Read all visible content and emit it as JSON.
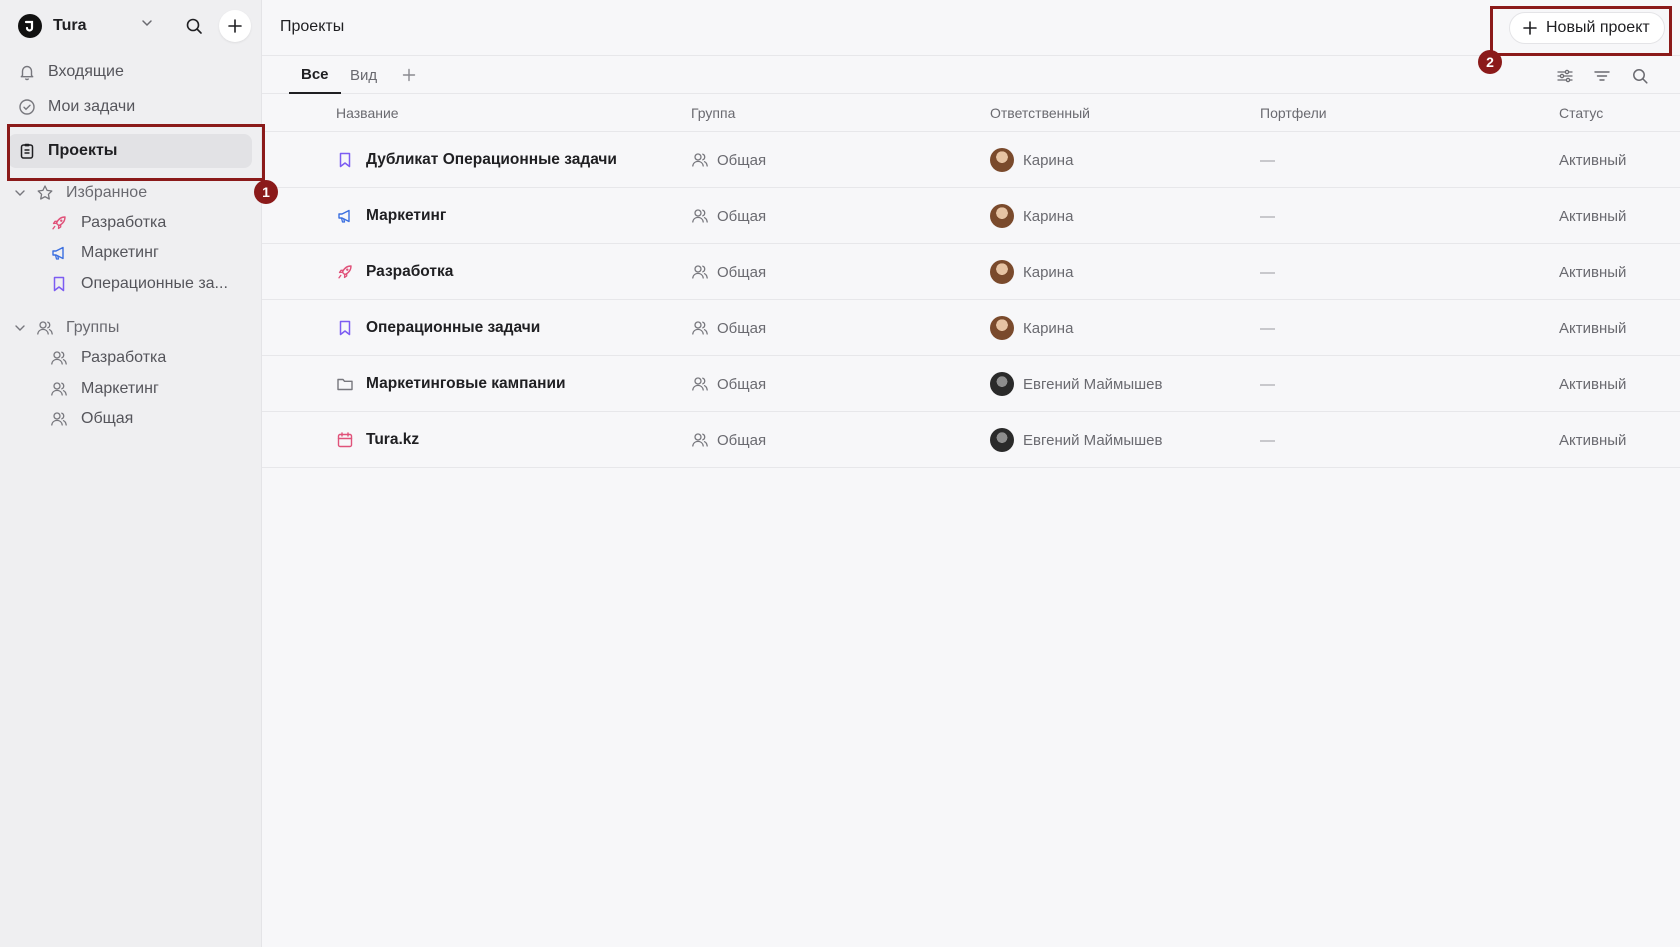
{
  "workspace": {
    "name": "Tura"
  },
  "sidebar": {
    "nav": [
      {
        "label": "Входящие",
        "icon": "bell-icon"
      },
      {
        "label": "Мои задачи",
        "icon": "check-circle-icon"
      },
      {
        "label": "Проекты",
        "icon": "clipboard-icon",
        "active": true
      }
    ],
    "favorites": {
      "title": "Избранное",
      "items": [
        {
          "label": "Разработка",
          "icon": "rocket-icon"
        },
        {
          "label": "Маркетинг",
          "icon": "megaphone-icon"
        },
        {
          "label": "Операционные за...",
          "icon": "bookmark-icon"
        }
      ]
    },
    "groups": {
      "title": "Группы",
      "items": [
        {
          "label": "Разработка",
          "icon": "users-icon"
        },
        {
          "label": "Маркетинг",
          "icon": "users-icon"
        },
        {
          "label": "Общая",
          "icon": "users-icon"
        }
      ]
    }
  },
  "header": {
    "title": "Проекты",
    "new_button": "Новый проект"
  },
  "tabs": [
    {
      "label": "Все",
      "active": true
    },
    {
      "label": "Вид",
      "active": false
    }
  ],
  "table": {
    "columns": [
      "Название",
      "Группа",
      "Ответственный",
      "Портфели",
      "Статус"
    ],
    "rows": [
      {
        "name": "Дубликат Операционные задачи",
        "icon": "bookmark-icon",
        "group": "Общая",
        "owner": "Карина",
        "portfolio": "—",
        "status": "Активный"
      },
      {
        "name": "Маркетинг",
        "icon": "megaphone-icon",
        "group": "Общая",
        "owner": "Карина",
        "portfolio": "—",
        "status": "Активный"
      },
      {
        "name": "Разработка",
        "icon": "rocket-icon",
        "group": "Общая",
        "owner": "Карина",
        "portfolio": "—",
        "status": "Активный"
      },
      {
        "name": "Операционные задачи",
        "icon": "bookmark-icon",
        "group": "Общая",
        "owner": "Карина",
        "portfolio": "—",
        "status": "Активный"
      },
      {
        "name": "Маркетинговые кампании",
        "icon": "folder-icon",
        "group": "Общая",
        "owner": "Евгений Маймышев",
        "portfolio": "—",
        "status": "Активный"
      },
      {
        "name": "Tura.kz",
        "icon": "calendar-icon",
        "group": "Общая",
        "owner": "Евгений Маймышев",
        "portfolio": "—",
        "status": "Активный"
      }
    ]
  },
  "annotations": [
    "1",
    "2"
  ],
  "colors": {
    "annotation": "#8b1a1a",
    "bookmark": "#7c5cf2",
    "megaphone": "#3b6fe0",
    "rocket": "#e0527a",
    "calendar": "#e0527a"
  }
}
